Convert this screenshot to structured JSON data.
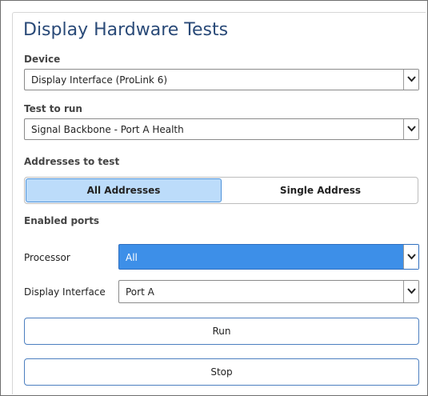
{
  "title": "Display Hardware Tests",
  "device": {
    "label": "Device",
    "value": "Display Interface (ProLink 6)"
  },
  "test": {
    "label": "Test to run",
    "value": "Signal Backbone - Port A Health"
  },
  "addresses": {
    "label": "Addresses to test",
    "options": [
      "All Addresses",
      "Single Address"
    ],
    "selected": "All Addresses"
  },
  "ports": {
    "label": "Enabled ports",
    "processor": {
      "label": "Processor",
      "value": "All"
    },
    "display_interface": {
      "label": "Display Interface",
      "value": "Port A"
    }
  },
  "actions": {
    "run_label": "Run",
    "stop_label": "Stop"
  },
  "colors": {
    "title": "#2a4a78",
    "active_segment": "#bcdcfa",
    "highlight_select": "#3d8fe8",
    "button_border": "#4c7fc0"
  },
  "icons": {
    "dropdown": "chevron-down-icon"
  }
}
